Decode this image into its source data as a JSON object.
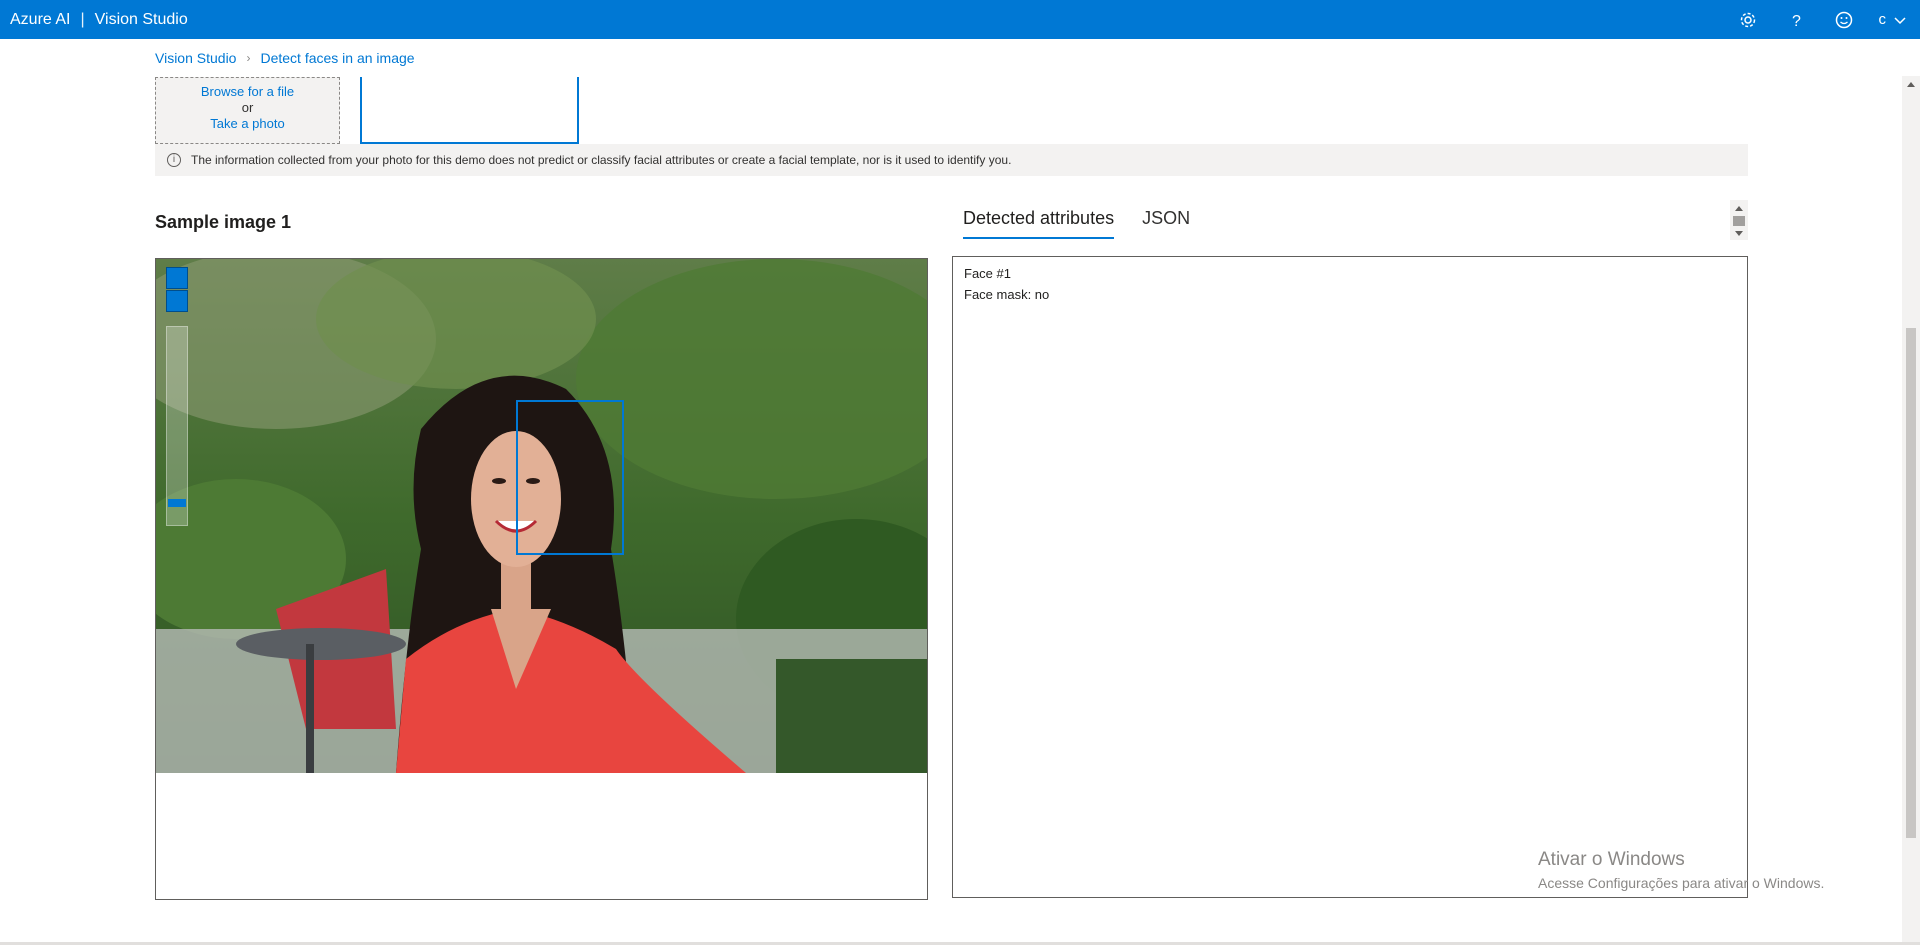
{
  "app": {
    "brand": "Azure AI",
    "separator": "|",
    "product": "Vision Studio",
    "user_initial": "c",
    "accent_color": "#0078d4",
    "icons": [
      "gear-icon",
      "help-icon",
      "feedback-smiley-icon",
      "chevron-down-icon"
    ]
  },
  "breadcrumb": {
    "root": "Vision Studio",
    "current": "Detect faces in an image"
  },
  "upload": {
    "browse_label": "Browse for a file",
    "or_label": "or",
    "photo_label": "Take a photo"
  },
  "notice": {
    "icon": "info-icon",
    "text": "The information collected from your photo for this demo does not predict or classify facial attributes or create a facial template, nor is it used to identify you."
  },
  "sample": {
    "title": "Sample image 1"
  },
  "tabs": [
    {
      "label": "Detected attributes",
      "active": true
    },
    {
      "label": "JSON",
      "active": false
    }
  ],
  "results": {
    "face_label": "Face #1",
    "mask_label": "Face mask: no"
  },
  "watermark": {
    "title": "Ativar o Windows",
    "subtitle": "Acesse Configurações para ativar o Windows."
  }
}
